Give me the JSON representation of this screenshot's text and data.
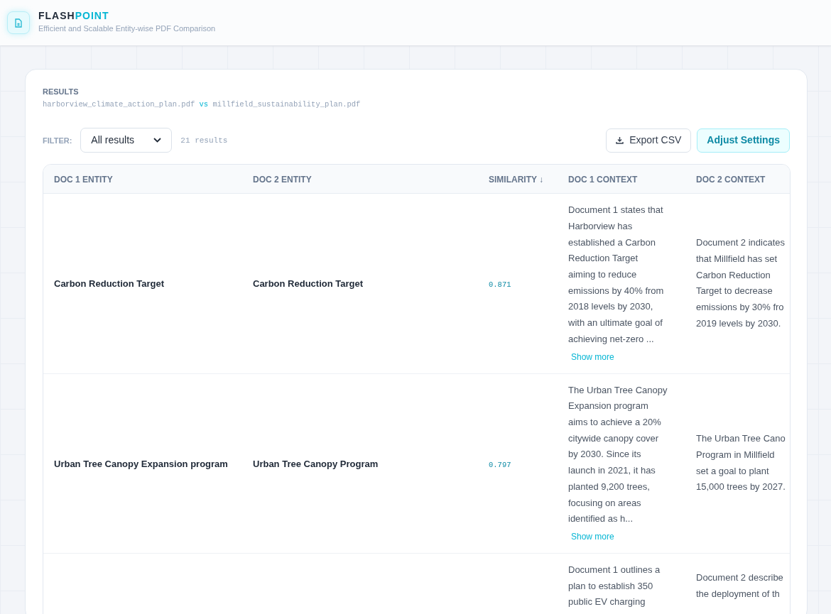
{
  "app": {
    "name_part_1": "FLASH",
    "name_part_2": "POINT",
    "subtitle": "Efficient and Scalable Entity-wise PDF Comparison"
  },
  "results": {
    "heading": "RESULTS",
    "file_1": "harborview_climate_action_plan.pdf",
    "separator": "vs",
    "file_2": "millfield_sustainability_plan.pdf",
    "filter_label": "FILTER:",
    "filter_value": "All results",
    "count": "21 results",
    "export_button": "Export CSV",
    "settings_button": "Adjust Settings"
  },
  "table": {
    "columns": [
      "DOC 1 ENTITY",
      "DOC 2 ENTITY",
      "SIMILARITY ↓",
      "DOC 1 CONTEXT",
      "DOC 2 CONTEXT"
    ],
    "rows": [
      {
        "doc1_entity": "Carbon Reduction Target",
        "doc2_entity": "Carbon Reduction Target",
        "similarity": "0.871",
        "doc1_context": [
          "Document 1 states that",
          "Harborview has",
          "established a Carbon",
          "Reduction Target",
          "aiming to reduce",
          "emissions by 40% from",
          "2018 levels by 2030,",
          "with an ultimate goal of",
          "achieving net-zero ..."
        ],
        "show_more": "Show more",
        "doc2_context": [
          "Document 2 indicates",
          "that Millfield has set",
          "Carbon Reduction",
          "Target to decrease",
          "emissions by 30% fro",
          "2019 levels by 2030."
        ]
      },
      {
        "doc1_entity": "Urban Tree Canopy Expansion program",
        "doc2_entity": "Urban Tree Canopy Program",
        "similarity": "0.797",
        "doc1_context": [
          "The Urban Tree Canopy",
          "Expansion program",
          "aims to achieve a 20%",
          "citywide canopy cover",
          "by 2030. Since its",
          "launch in 2021, it has",
          "planted 9,200 trees,",
          "focusing on areas",
          "identified as h..."
        ],
        "show_more": "Show more",
        "doc2_context": [
          "The Urban Tree Cano",
          "Program in Millfield",
          "set a goal to plant",
          "15,000 trees by 2027."
        ]
      },
      {
        "doc1_context": [
          "Document 1 outlines a",
          "plan to establish 350",
          "public EV charging"
        ],
        "doc2_context": [
          "Document 2 describe",
          "the deployment of th"
        ]
      }
    ]
  }
}
